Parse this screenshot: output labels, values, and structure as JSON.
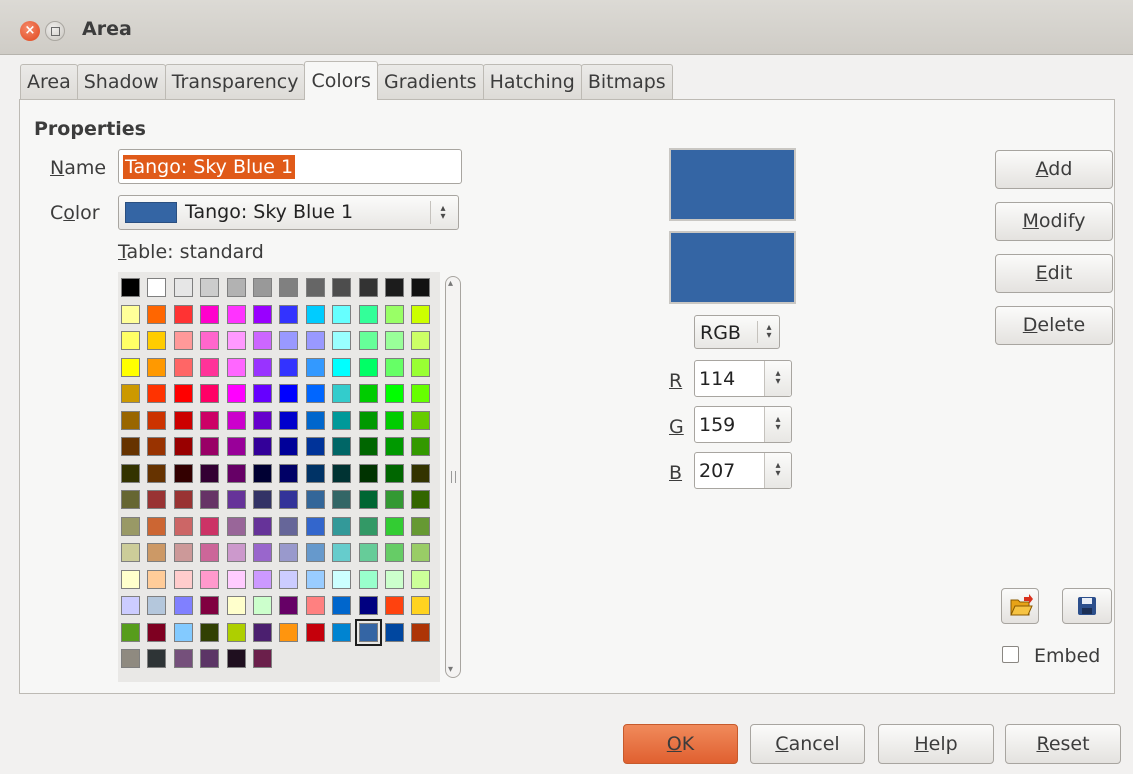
{
  "window": {
    "title": "Area"
  },
  "tabs": [
    {
      "label": "Area",
      "active": false
    },
    {
      "label": "Shadow",
      "active": false
    },
    {
      "label": "Transparency",
      "active": false
    },
    {
      "label": "Colors",
      "active": true
    },
    {
      "label": "Gradients",
      "active": false
    },
    {
      "label": "Hatching",
      "active": false
    },
    {
      "label": "Bitmaps",
      "active": false
    }
  ],
  "properties": {
    "heading": "Properties",
    "name_label_mnemonic": "N",
    "name_label_rest": "ame",
    "name_value": "Tango: Sky Blue 1",
    "color_label_pre": "C",
    "color_label_mnemonic": "o",
    "color_label_rest": "lor",
    "color_value": "Tango: Sky Blue 1",
    "table_label_mnemonic": "T",
    "table_label_rest": "able: standard"
  },
  "palette": {
    "rows": [
      [
        "#000000",
        "#ffffff",
        "#e6e6e6",
        "#cccccc",
        "#b2b2b2",
        "#999999",
        "#808080",
        "#666666",
        "#4d4d4d",
        "#333333",
        "#1c1c1c",
        "#111111"
      ],
      [
        "#ffff99",
        "#ff6600",
        "#ff3333",
        "#ff00cc",
        "#ff33ff",
        "#9900ff",
        "#3333ff",
        "#00ccff",
        "#66ffff",
        "#33ff99",
        "#99ff66",
        "#ccff00"
      ],
      [
        "#ffff66",
        "#ffcc00",
        "#ff9999",
        "#ff66cc",
        "#ff99ff",
        "#cc66ff",
        "#9999ff",
        "#9999ff",
        "#99ffff",
        "#66ff99",
        "#99ff99",
        "#ccff66"
      ],
      [
        "#ffff00",
        "#ff9900",
        "#ff6666",
        "#ff3399",
        "#ff66ff",
        "#9933ff",
        "#3333ff",
        "#3399ff",
        "#00ffff",
        "#00ff66",
        "#66ff66",
        "#99ff33"
      ],
      [
        "#cc9900",
        "#ff3300",
        "#ff0000",
        "#ff0066",
        "#ff00ff",
        "#6600ff",
        "#0000ff",
        "#0066ff",
        "#33cccc",
        "#00cc00",
        "#00ff00",
        "#66ff00"
      ],
      [
        "#996600",
        "#cc3300",
        "#cc0000",
        "#cc0066",
        "#cc00cc",
        "#6600cc",
        "#0000cc",
        "#0066cc",
        "#009999",
        "#009900",
        "#00cc00",
        "#66cc00"
      ],
      [
        "#663300",
        "#993300",
        "#990000",
        "#990066",
        "#990099",
        "#330099",
        "#000099",
        "#003399",
        "#006666",
        "#006600",
        "#009900",
        "#339900"
      ],
      [
        "#333300",
        "#663300",
        "#330000",
        "#330033",
        "#660066",
        "#000033",
        "#000066",
        "#003366",
        "#003333",
        "#003300",
        "#006600",
        "#333300"
      ],
      [
        "#666633",
        "#993333",
        "#993333",
        "#663366",
        "#663399",
        "#333366",
        "#333399",
        "#336699",
        "#336666",
        "#006633",
        "#339933",
        "#336600"
      ],
      [
        "#999966",
        "#cc6633",
        "#cc6666",
        "#cc3366",
        "#996699",
        "#663399",
        "#666699",
        "#3366cc",
        "#339999",
        "#339966",
        "#33cc33",
        "#669933"
      ],
      [
        "#cccc99",
        "#cc9966",
        "#cc9999",
        "#cc6699",
        "#cc99cc",
        "#9966cc",
        "#9999cc",
        "#6699cc",
        "#66cccc",
        "#66cc99",
        "#66cc66",
        "#99cc66"
      ],
      [
        "#ffffcc",
        "#ffcc99",
        "#ffcccc",
        "#ff99cc",
        "#ffccff",
        "#cc99ff",
        "#ccccff",
        "#99ccff",
        "#ccffff",
        "#99ffcc",
        "#ccffcc",
        "#ccff99"
      ],
      [
        "#ccccff",
        "#b4c7dc",
        "#8080ff",
        "#800040",
        "#ffffcc",
        "#ccffcc",
        "#660066",
        "#ff8080",
        "#0066cc",
        "#000080",
        "#ff420e",
        "#ffd320"
      ],
      [
        "#579d1c",
        "#7e0021",
        "#83caff",
        "#314004",
        "#aecf00",
        "#4b1f6f",
        "#ff950e",
        "#c5000b",
        "#0084d1",
        "#3465a4",
        "#0047a0",
        "#ad3406"
      ],
      [
        "#8f8a80",
        "#2e3436",
        "#75507b",
        "#5c3566",
        "#1f0f1f",
        "#6b1f4b"
      ]
    ],
    "selected": [
      13,
      9
    ]
  },
  "preview": {
    "color": "#3465a4"
  },
  "color_model": {
    "value": "RGB"
  },
  "rgb": {
    "r_label": "R",
    "r_value": "114",
    "g_label": "G",
    "g_value": "159",
    "b_label": "B",
    "b_value": "207"
  },
  "actions": {
    "add_mnemonic": "A",
    "add_rest": "dd",
    "modify_mnemonic": "M",
    "modify_rest": "odify",
    "edit_mnemonic": "E",
    "edit_rest": "dit",
    "delete_mnemonic": "D",
    "delete_rest": "elete",
    "embed_label": "Embed"
  },
  "footer": {
    "ok_mnemonic": "O",
    "ok_rest": "K",
    "cancel_mnemonic": "C",
    "cancel_rest": "ancel",
    "help_mnemonic": "H",
    "help_rest": "elp",
    "reset_mnemonic": "R",
    "reset_rest": "eset"
  }
}
